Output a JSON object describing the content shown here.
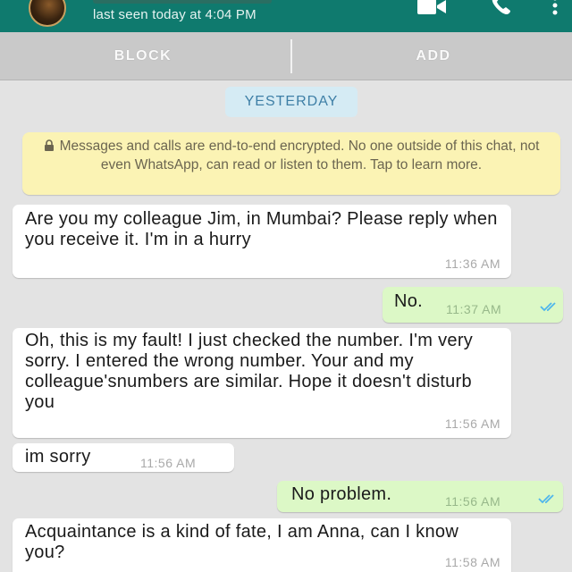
{
  "header": {
    "last_seen": "last seen today at 4:04 PM",
    "icons": [
      "avatar",
      "video-call-icon",
      "voice-call-icon",
      "more-options-icon"
    ],
    "colors": {
      "header_bg": "#0f7a6e",
      "accent": "#0f7a6e"
    }
  },
  "actions": {
    "block_label": "BLOCK",
    "add_label": "ADD"
  },
  "chat": {
    "date_label": "YESTERDAY",
    "encryption_notice": "Messages and calls are end-to-end encrypted. No one outside of this chat, not even WhatsApp, can read or listen to them. Tap to learn more.",
    "messages": [
      {
        "direction": "incoming",
        "text": "Are you my colleague Jim, in Mumbai? Please reply when you receive it. I'm in a hurry",
        "time": "11:36 AM"
      },
      {
        "direction": "outgoing",
        "text": "No.",
        "time": "11:37 AM",
        "status": "read"
      },
      {
        "direction": "incoming",
        "text": "Oh, this is my fault! I just checked the number. I'm very sorry. I entered the wrong number. Your and my colleague'snumbers are similar. Hope it doesn't disturb you",
        "time": "11:56 AM"
      },
      {
        "direction": "incoming",
        "text": "im sorry",
        "time": "11:56 AM"
      },
      {
        "direction": "outgoing",
        "text": "No problem.",
        "time": "11:56 AM",
        "status": "read"
      },
      {
        "direction": "incoming",
        "text": "Acquaintance is a kind of fate, I am Anna, can I know you?",
        "time": "11:58 AM"
      }
    ],
    "colors": {
      "incoming_bubble": "#ffffff",
      "outgoing_bubble": "#dcf8c6",
      "read_tick": "#4fb6ec",
      "notice_bg": "#fbf3b4"
    }
  }
}
